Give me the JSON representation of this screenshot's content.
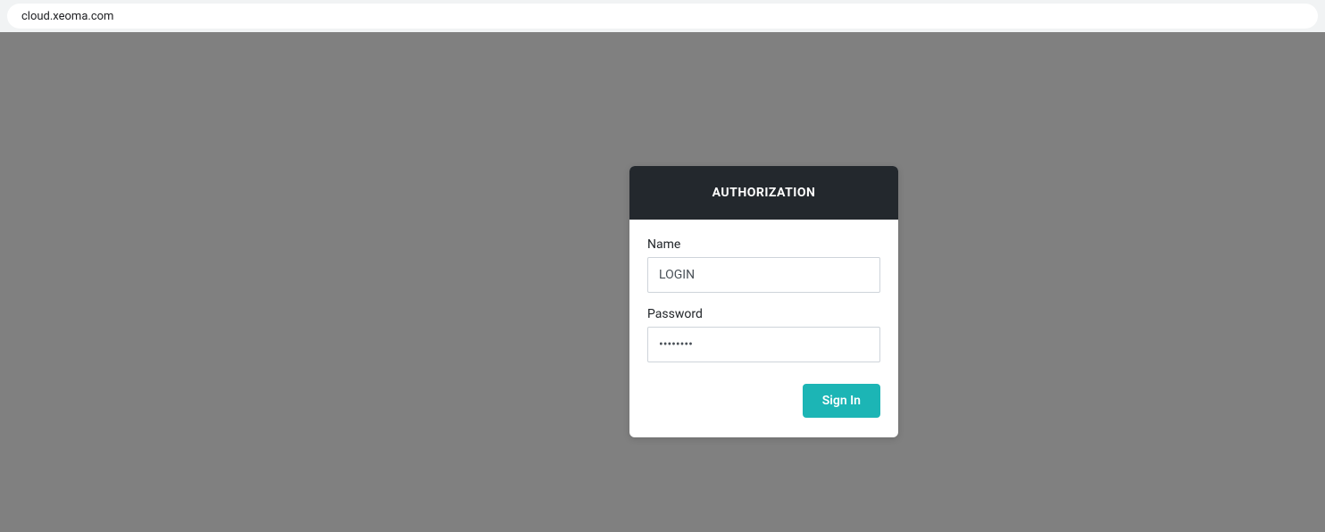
{
  "browser": {
    "url": "cloud.xeoma.com"
  },
  "auth": {
    "title": "AUTHORIZATION",
    "name_label": "Name",
    "name_value": "LOGIN",
    "password_label": "Password",
    "password_value": "••••••••",
    "signin_label": "Sign In"
  }
}
